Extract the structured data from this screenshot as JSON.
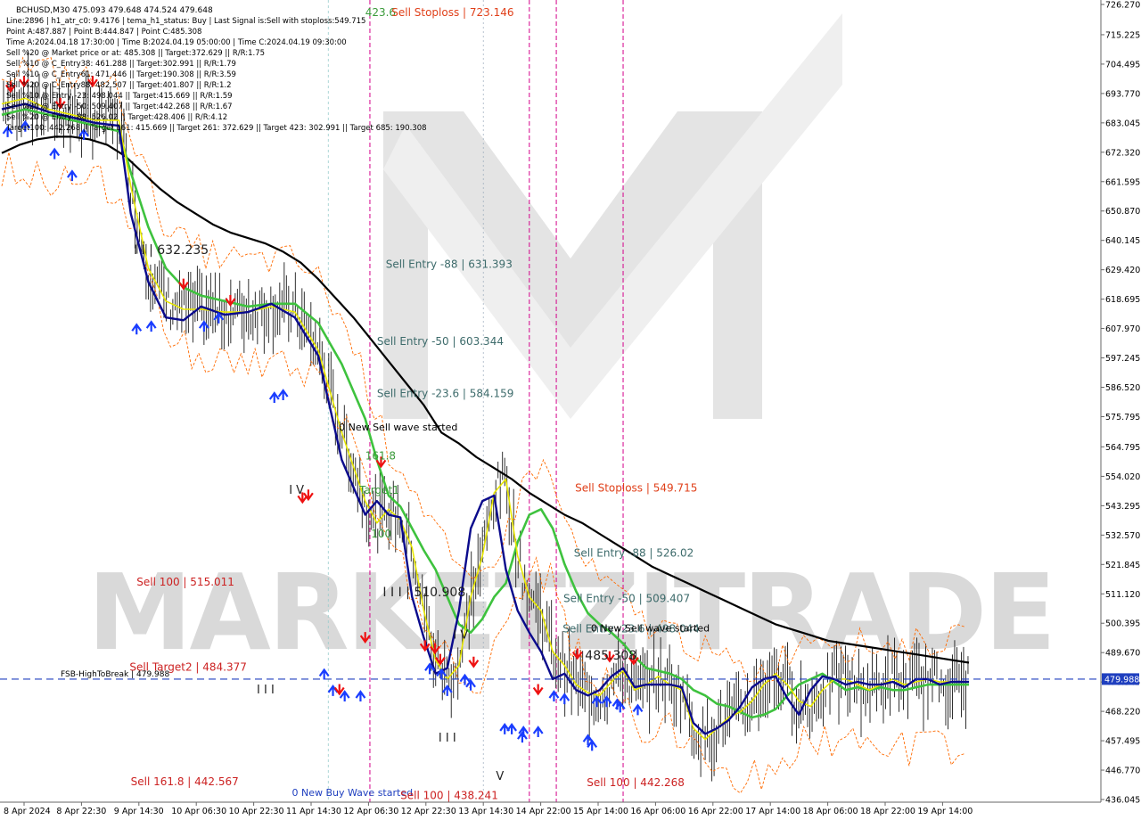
{
  "header": {
    "symbol_line": "BCHUSD,M30  475.093 479.648 474.524 479.648",
    "info_lines": [
      "Line:2896 | h1_atr_c0: 9.4176 | tema_h1_status: Buy | Last Signal is:Sell with stoploss:549.715",
      "Point A:487.887 | Point B:444.847 | Point C:485.308",
      "Time A:2024.04.18 17:30:00 | Time B:2024.04.19 05:00:00 | Time C:2024.04.19 09:30:00",
      "Sell %20 @ Market price or at: 485.308 || Target:372.629 || R/R:1.75",
      "Sell %10 @ C_Entry38: 461.288 || Target:302.991 || R/R:1.79",
      "Sell %10 @ C_Entry61: 471.446 || Target:190.308 || R/R:3.59",
      "Sell %20 @ C_Entry88: 482.507 || Target:401.807 || R/R:1.2",
      "Sell %10 @ Entry -23: 498.044 || Target:415.669 || R/R:1.59",
      "Sell %20 @ Entry -50: 509.407 || Target:442.268 || R/R:1.67",
      "Sell %20 @ Entry -88: 526.02 || Target:428.406 || R/R:4.12",
      "Target100: 442.268 || Target 161: 415.669 || Target 261: 372.629 || Target 423: 302.991 || Target 685: 190.308"
    ]
  },
  "watermark": {
    "text": "MARKETZITRADE"
  },
  "price_tag": {
    "value": "479.988",
    "color": "#1f3fbf"
  },
  "chart_data": {
    "type": "line",
    "title": "BCHUSD,M30",
    "ylim": [
      436.045,
      726.27
    ],
    "y_ticks": [
      "726.270",
      "715.225",
      "704.495",
      "693.770",
      "683.045",
      "672.320",
      "661.595",
      "650.870",
      "640.145",
      "629.420",
      "618.695",
      "607.970",
      "597.245",
      "586.520",
      "575.795",
      "564.795",
      "554.020",
      "543.295",
      "532.570",
      "521.845",
      "511.120",
      "500.395",
      "489.670",
      "478.945",
      "468.220",
      "457.495",
      "446.770",
      "436.045"
    ],
    "x_ticks": [
      "8 Apr 2024",
      "8 Apr 22:30",
      "9 Apr 14:30",
      "10 Apr 06:30",
      "10 Apr 22:30",
      "11 Apr 14:30",
      "12 Apr 06:30",
      "12 Apr 22:30",
      "13 Apr 14:30",
      "14 Apr 22:00",
      "15 Apr 14:00",
      "16 Apr 06:00",
      "16 Apr 22:00",
      "17 Apr 14:00",
      "18 Apr 06:00",
      "18 Apr 22:00",
      "19 Apr 14:00"
    ],
    "series": [
      {
        "color": "#000000",
        "x": [
          0,
          3,
          6,
          9,
          12,
          15,
          18,
          21,
          24,
          27,
          30,
          33,
          36,
          39,
          42,
          45,
          48,
          51,
          54,
          57,
          60,
          63,
          66,
          69,
          72,
          75,
          78,
          81,
          84,
          87,
          90,
          93,
          96,
          99,
          102,
          105,
          108,
          111,
          114,
          117,
          120,
          123,
          126,
          129,
          132,
          135,
          138,
          141,
          144,
          147,
          150,
          153,
          156,
          159,
          162,
          165
        ],
        "y": [
          672,
          675,
          677,
          678,
          678,
          677,
          675,
          671,
          665,
          659,
          654,
          650,
          646,
          643,
          641,
          639,
          636,
          632,
          626,
          619,
          612,
          604,
          596,
          588,
          580,
          570,
          566,
          561,
          557,
          553,
          548,
          544,
          540,
          537,
          533,
          529,
          525,
          521,
          518,
          515,
          512,
          509,
          506,
          503,
          500,
          498,
          496,
          494,
          493,
          492,
          491,
          490,
          489,
          488,
          487,
          486
        ]
      },
      {
        "color": "#3ec23e",
        "x": [
          0,
          4,
          8,
          12,
          16,
          20,
          22,
          25,
          28,
          31,
          34,
          38,
          42,
          46,
          50,
          54,
          58,
          62,
          64,
          66,
          68,
          70,
          72,
          74,
          76,
          78,
          80,
          82,
          84,
          86,
          88,
          90,
          92,
          94,
          96,
          98,
          100,
          102,
          104,
          106,
          108,
          110,
          112,
          114,
          116,
          118,
          120,
          122,
          124,
          126,
          128,
          130,
          132,
          134,
          136,
          138,
          140,
          142,
          144,
          146,
          148,
          150,
          152,
          154,
          156,
          158,
          160,
          162,
          165
        ],
        "y": [
          686,
          688,
          686,
          684,
          682,
          680,
          665,
          645,
          630,
          623,
          620,
          618,
          616,
          617,
          617,
          610,
          595,
          575,
          560,
          547,
          543,
          535,
          527,
          520,
          510,
          500,
          497,
          502,
          510,
          515,
          530,
          540,
          542,
          535,
          522,
          512,
          504,
          500,
          497,
          493,
          488,
          484,
          483,
          482,
          480,
          476,
          474,
          471,
          470,
          468,
          466,
          467,
          469,
          474,
          478,
          480,
          482,
          479,
          476,
          477,
          476,
          477,
          476,
          476,
          477,
          478,
          478,
          478,
          478
        ]
      },
      {
        "color": "#e8e800",
        "x": [
          0,
          4,
          8,
          12,
          16,
          20,
          22,
          25,
          28,
          31,
          34,
          38,
          42,
          46,
          50,
          54,
          58,
          62,
          64,
          66,
          68,
          70,
          72,
          74,
          76,
          78,
          80,
          82,
          84,
          86,
          88,
          90,
          92,
          94,
          96,
          98,
          100,
          102,
          104,
          106,
          108,
          110,
          112,
          114,
          116,
          118,
          120,
          122,
          124,
          126,
          128,
          130,
          132,
          134,
          136,
          138,
          140,
          142,
          144,
          146,
          148,
          150,
          152,
          154,
          156,
          158,
          160,
          162,
          165
        ],
        "y": [
          690,
          692,
          688,
          686,
          684,
          684,
          660,
          630,
          618,
          615,
          615,
          614,
          614,
          616,
          614,
          600,
          570,
          545,
          537,
          542,
          538,
          528,
          505,
          487,
          480,
          485,
          510,
          525,
          548,
          553,
          525,
          510,
          505,
          490,
          485,
          478,
          475,
          474,
          479,
          483,
          476,
          478,
          481,
          478,
          476,
          462,
          458,
          462,
          466,
          468,
          472,
          478,
          482,
          478,
          472,
          470,
          476,
          480,
          480,
          478,
          476,
          478,
          480,
          478,
          479,
          480,
          479,
          479,
          479
        ]
      },
      {
        "color": "#0a0a8c",
        "x": [
          0,
          4,
          8,
          12,
          16,
          20,
          22,
          25,
          28,
          31,
          34,
          38,
          42,
          46,
          50,
          54,
          58,
          62,
          64,
          66,
          68,
          70,
          72,
          74,
          76,
          78,
          80,
          82,
          84,
          86,
          88,
          90,
          92,
          94,
          96,
          98,
          100,
          102,
          104,
          106,
          108,
          110,
          112,
          114,
          116,
          118,
          120,
          122,
          124,
          126,
          128,
          130,
          132,
          134,
          136,
          138,
          140,
          142,
          144,
          146,
          148,
          150,
          152,
          154,
          156,
          158,
          160,
          162,
          165
        ],
        "y": [
          688,
          690,
          687,
          685,
          683,
          682,
          650,
          625,
          612,
          611,
          616,
          613,
          614,
          617,
          612,
          598,
          560,
          540,
          545,
          540,
          539,
          510,
          495,
          482,
          484,
          505,
          535,
          545,
          547,
          520,
          505,
          497,
          490,
          480,
          482,
          476,
          474,
          476,
          481,
          484,
          477,
          478,
          478,
          478,
          477,
          464,
          460,
          462,
          465,
          470,
          477,
          480,
          481,
          473,
          467,
          476,
          481,
          480,
          478,
          479,
          478,
          478,
          479,
          477,
          480,
          480,
          478,
          479,
          479
        ]
      }
    ],
    "price_labels": [
      {
        "text": "423.6",
        "x": 62,
        "y": 723.4,
        "color": "#3a9a3a",
        "size": 12
      },
      {
        "text": "Sell Stoploss | 723.146",
        "x": 66.5,
        "y": 723.4,
        "color": "#e0401a",
        "size": 12
      },
      {
        "text": "I I | 632.235",
        "x": 22.5,
        "y": 636.5,
        "color": "#222222",
        "size": 14
      },
      {
        "text": "Sell Entry -88 | 631.393",
        "x": 65.5,
        "y": 631.4,
        "color": "#3d6b6b",
        "size": 12
      },
      {
        "text": "Sell Entry -50 | 603.344",
        "x": 64,
        "y": 603.3,
        "color": "#3d6b6b",
        "size": 12
      },
      {
        "text": "Sell Entry -23.6 | 584.159",
        "x": 64,
        "y": 584.2,
        "color": "#3d6b6b",
        "size": 12
      },
      {
        "text": "0 New Sell wave started",
        "x": 57.5,
        "y": 572,
        "color": "#000000",
        "size": 11
      },
      {
        "text": "161.8",
        "x": 62,
        "y": 561.5,
        "color": "#3a9a3a",
        "size": 12
      },
      {
        "text": "Target1",
        "x": 61,
        "y": 549,
        "color": "#3a9a3a",
        "size": 12
      },
      {
        "text": "I V",
        "x": 49,
        "y": 549,
        "color": "#222222",
        "size": 13
      },
      {
        "text": "100",
        "x": 63,
        "y": 533,
        "color": "#3a9a3a",
        "size": 12
      },
      {
        "text": "Sell Stoploss | 549.715",
        "x": 97.8,
        "y": 549.7,
        "color": "#e0401a",
        "size": 12
      },
      {
        "text": "Sell Entry -88 | 526.02",
        "x": 97.6,
        "y": 526,
        "color": "#3d6b6b",
        "size": 12
      },
      {
        "text": "Sell 100 | 515.011",
        "x": 23,
        "y": 515.5,
        "color": "#cc2222",
        "size": 12
      },
      {
        "text": "I I I | 510.908",
        "x": 65,
        "y": 511.6,
        "color": "#222222",
        "size": 14
      },
      {
        "text": "Sell Entry -50 | 509.407",
        "x": 95.8,
        "y": 509.4,
        "color": "#3d6b6b",
        "size": 12
      },
      {
        "text": "Sell Entry -23.6 | 498.044",
        "x": 95.7,
        "y": 498.3,
        "color": "#3d6b6b",
        "size": 12
      },
      {
        "text": "0 New Sell wave started",
        "x": 100.5,
        "y": 498.6,
        "color": "#000000",
        "size": 11
      },
      {
        "text": "I V",
        "x": 77,
        "y": 496,
        "color": "#222222",
        "size": 13
      },
      {
        "text": "485.308",
        "x": 99.5,
        "y": 488.5,
        "color": "#222222",
        "size": 14
      },
      {
        "text": "Sell Target2 | 484.377",
        "x": 21.8,
        "y": 484.4,
        "color": "#cc2222",
        "size": 12
      },
      {
        "text": "I I I",
        "x": 43.5,
        "y": 476,
        "color": "#222222",
        "size": 13
      },
      {
        "text": "I I I",
        "x": 74.5,
        "y": 458.5,
        "color": "#222222",
        "size": 13
      },
      {
        "text": "V",
        "x": 84.3,
        "y": 444.5,
        "color": "#222222",
        "size": 13
      },
      {
        "text": "Sell 161.8 | 442.567",
        "x": 22,
        "y": 442.6,
        "color": "#cc2222",
        "size": 12
      },
      {
        "text": "Sell 100 | 442.268",
        "x": 99.8,
        "y": 442.3,
        "color": "#cc2222",
        "size": 12
      },
      {
        "text": "0 New Buy Wave started",
        "x": 49.5,
        "y": 438.6,
        "color": "#1f3fbf",
        "size": 11
      },
      {
        "text": "Sell 100 | 438.241",
        "x": 68,
        "y": 437.5,
        "color": "#cc2222",
        "size": 12
      }
    ],
    "hline": {
      "y": 479.988,
      "label": "FSB-HighToBreak | 479.988",
      "color": "#1f3fbf"
    },
    "vlines_magenta": [
      62.8,
      90,
      94.6,
      106
    ],
    "vlines_grey": [
      55.7
    ],
    "arrows_up": [
      [
        1,
        684
      ],
      [
        4,
        686
      ],
      [
        9,
        676
      ],
      [
        12,
        668
      ],
      [
        14,
        683
      ],
      [
        23,
        612
      ],
      [
        25.5,
        613
      ],
      [
        34.5,
        613
      ],
      [
        37,
        616
      ],
      [
        46.5,
        587
      ],
      [
        48,
        588
      ],
      [
        55,
        486
      ],
      [
        56.5,
        480
      ],
      [
        58.5,
        478
      ],
      [
        61.2,
        478
      ],
      [
        73,
        488
      ],
      [
        75,
        486
      ],
      [
        76,
        480
      ],
      [
        79,
        484
      ],
      [
        80,
        482
      ],
      [
        85.8,
        466
      ],
      [
        87,
        466
      ],
      [
        88.8,
        463
      ],
      [
        89,
        465
      ],
      [
        91.5,
        465
      ],
      [
        94.2,
        478
      ],
      [
        96,
        477
      ],
      [
        100,
        462
      ],
      [
        100.7,
        460
      ],
      [
        101.5,
        476
      ],
      [
        103.2,
        476
      ],
      [
        105,
        475
      ],
      [
        105.5,
        474
      ],
      [
        108.5,
        473
      ]
    ],
    "arrows_down": [
      [
        1.5,
        692
      ],
      [
        3.8,
        694
      ],
      [
        10,
        686
      ],
      [
        15.5,
        694
      ],
      [
        31,
        620
      ],
      [
        39,
        614
      ],
      [
        51.3,
        542
      ],
      [
        52.3,
        543
      ],
      [
        57.6,
        472
      ],
      [
        62,
        491
      ],
      [
        64.7,
        555
      ],
      [
        72.2,
        488
      ],
      [
        73.9,
        487
      ],
      [
        74.8,
        483
      ],
      [
        80.5,
        482
      ],
      [
        91.5,
        472
      ],
      [
        98.2,
        485
      ],
      [
        103.7,
        484
      ],
      [
        107.8,
        483
      ]
    ]
  }
}
